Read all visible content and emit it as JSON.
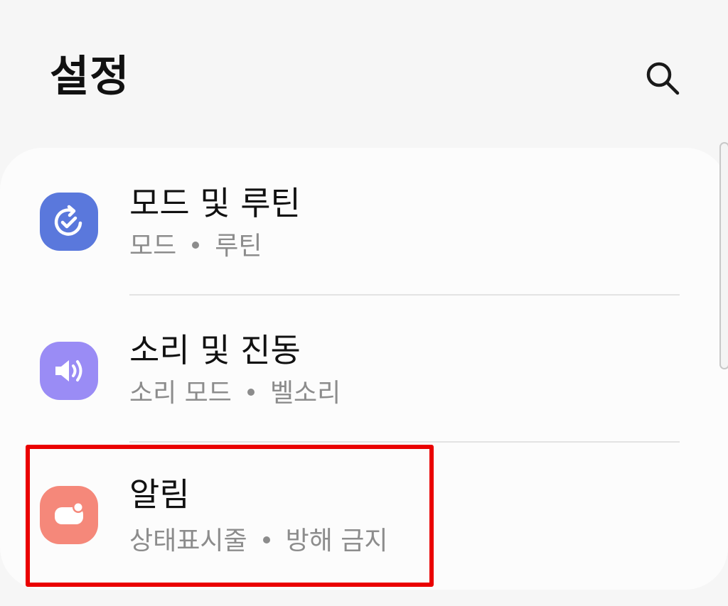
{
  "header": {
    "title": "설정",
    "search_icon": "search-icon"
  },
  "settings": {
    "items": [
      {
        "title": "모드 및 루틴",
        "sub1": "모드",
        "sub2": "루틴",
        "icon": "modes-routines-icon",
        "icon_color": "#5a78dc"
      },
      {
        "title": "소리 및 진동",
        "sub1": "소리 모드",
        "sub2": "벨소리",
        "icon": "sound-icon",
        "icon_color": "#9a8cf5"
      },
      {
        "title": "알림",
        "sub1": "상태표시줄",
        "sub2": "방해 금지",
        "icon": "notifications-icon",
        "icon_color": "#f5887a"
      }
    ]
  },
  "highlight": {
    "color": "#ea0000",
    "target": "알림"
  }
}
